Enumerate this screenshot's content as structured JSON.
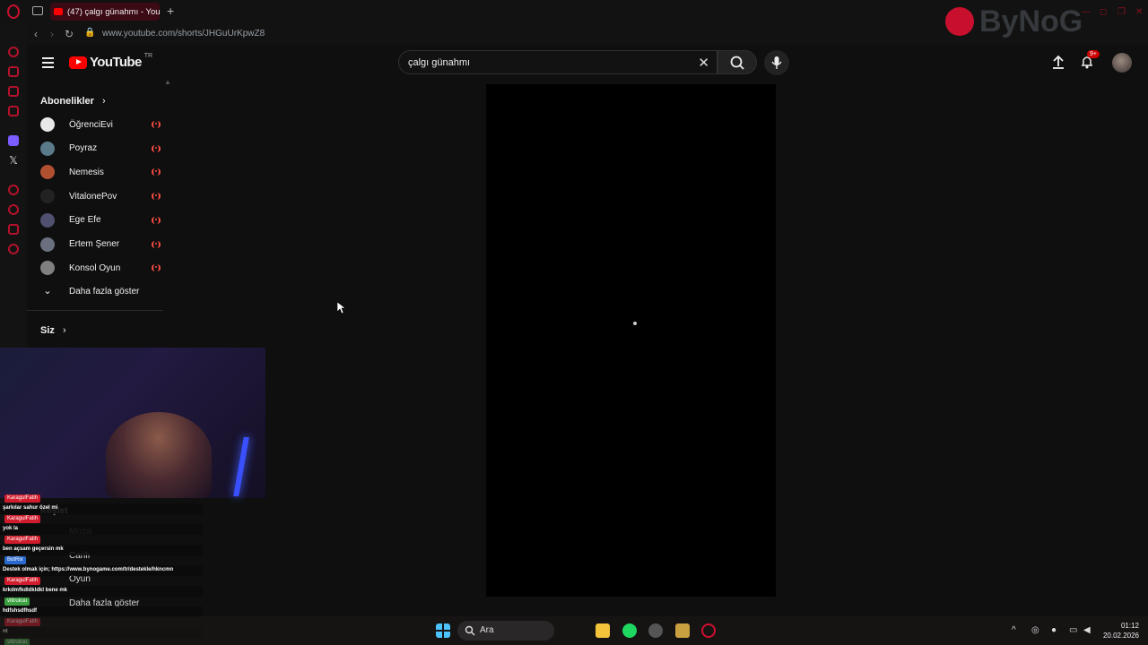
{
  "browser": {
    "tab_title": "(47) çalgı günahmı - YouTu",
    "url": "www.youtube.com/shorts/JHGuUrKpwZ8",
    "overlay_logo_text": "ByNoG"
  },
  "youtube": {
    "logo_text": "YouTube",
    "country_code": "TR",
    "search_query": "çalgı günahmı",
    "notifications_badge": "9+"
  },
  "sidebar": {
    "subscriptions_title": "Abonelikler",
    "channels": [
      {
        "name": "ÖğrenciEvi",
        "color": "#e8e8e8"
      },
      {
        "name": "Poyraz",
        "color": "#5a7a8a"
      },
      {
        "name": "Nemesis",
        "color": "#b05030"
      },
      {
        "name": "VitalonePov",
        "color": "#222222"
      },
      {
        "name": "Ege Efe",
        "color": "#505070"
      },
      {
        "name": "Ertem Şener",
        "color": "#6a7080"
      },
      {
        "name": "Konsol Oyun",
        "color": "#808080"
      }
    ],
    "show_more": "Daha fazla göster",
    "you_title": "Siz"
  },
  "behind_overlay": {
    "explore": "Keşfet",
    "music": "Müzik",
    "live": "Canlı",
    "gaming": "Oyun",
    "show_more": "Daha fazla göster"
  },
  "chat": [
    {
      "user": "KaragulFatih",
      "user_color": "#d01c2c",
      "msg": "şarkılar sahur özel mi"
    },
    {
      "user": "KaragulFatih",
      "user_color": "#d01c2c",
      "msg": "yok la"
    },
    {
      "user": "KaragulFatih",
      "user_color": "#d01c2c",
      "msg": "ben açsam geçersin mk"
    },
    {
      "user": "BotRix",
      "user_color": "#2a6ad0",
      "msg": "Destek olmak için; https://www.bynogame.com/tr/destekle/hkncmn"
    },
    {
      "user": "KaragulFatih",
      "user_color": "#d01c2c",
      "msg": "krkdmfkdldkldkl bene mk"
    },
    {
      "user": "vitirukuu",
      "user_color": "#3aa040",
      "msg": "hdfshsdfhsdf"
    },
    {
      "user": "KaragulFatih",
      "user_color": "#d01c2c",
      "msg": "nt"
    },
    {
      "user": "vitirukuu",
      "user_color": "#3aa040",
      "msg": ""
    }
  ],
  "taskbar": {
    "search_label": "Ara",
    "time": "01:12",
    "date": "20.02.2026"
  }
}
